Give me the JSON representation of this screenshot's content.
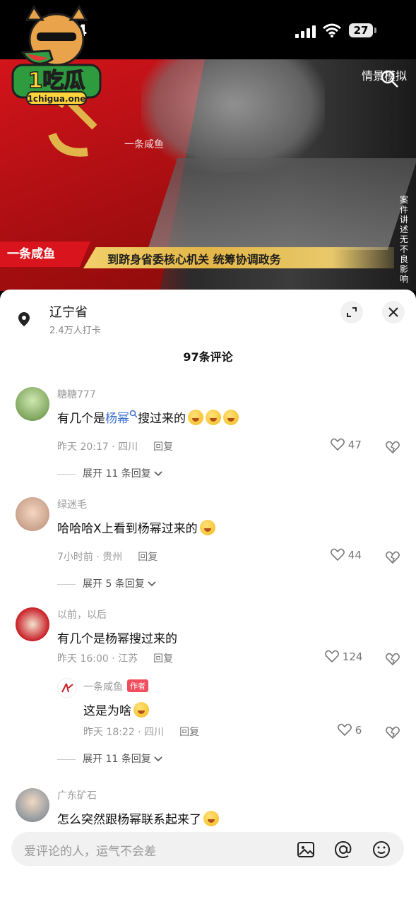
{
  "status_bar": {
    "time": "4",
    "battery": "27"
  },
  "video": {
    "watermark_top": "一条咸鱼",
    "top_right_label": "情景模拟",
    "side_vertical_text": "案件讲述 无不良影响",
    "left_tag": "一条咸鱼",
    "caption": "到跻身省委核心机关 统筹协调政务"
  },
  "logo": {
    "brand": "1吃瓜",
    "site": "1chigua.one"
  },
  "location": {
    "title": "辽宁省",
    "subtitle": "2.4万人打卡"
  },
  "comments_count": "97条评论",
  "comments": [
    {
      "username": "糖糖777",
      "text_before": "有几个是",
      "text_link": "杨幂",
      "text_after": "搜过来的",
      "meta": "昨天 20:17 · 四川",
      "reply": "回复",
      "likes": "47",
      "expand": "展开 11 条回复"
    },
    {
      "username": "绿迷毛",
      "text": "哈哈哈X上看到杨幂过来的",
      "meta": "7小时前 · 贵州",
      "reply": "回复",
      "likes": "44",
      "expand": "展开 5 条回复"
    },
    {
      "username": "以前，以后",
      "text": "有几个是杨幂搜过来的",
      "meta": "昨天 16:00 · 江苏",
      "reply": "回复",
      "likes": "124",
      "sub_reply": {
        "username": "一条咸鱼",
        "tag": "作者",
        "text": "这是为啥",
        "meta": "昨天 18:22 · 四川",
        "reply": "回复",
        "likes": "6"
      },
      "expand": "展开 11 条回复"
    },
    {
      "username": "广东矿石",
      "text": "怎么突然跟杨幂联系起来了"
    }
  ],
  "input": {
    "placeholder": "爱评论的人，运气不会差"
  }
}
